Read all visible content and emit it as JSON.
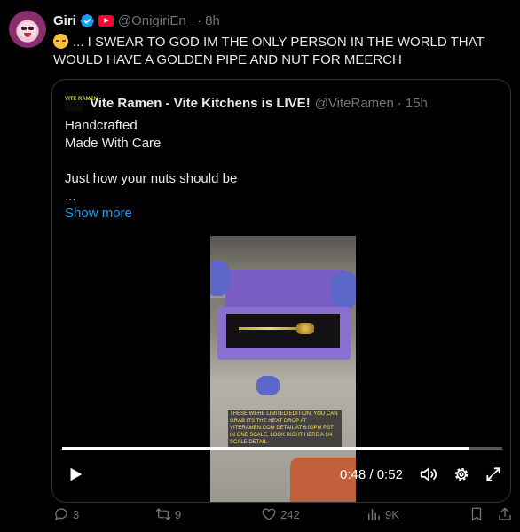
{
  "post": {
    "author_name": "Giri",
    "handle": "@OnigiriEn_",
    "separator": "·",
    "time": "8h",
    "text": "... I SWEAR TO GOD IM THE ONLY PERSON IN THE WORLD THAT WOULD HAVE A GOLDEN PIPE AND NUT FOR MEERCH"
  },
  "quote": {
    "avatar_text": "VITE RAMEN",
    "author_name": "Vite Ramen - Vite Kitchens is LIVE!",
    "handle": "@ViteRamen",
    "separator": "·",
    "time": "15h",
    "lines": [
      "Handcrafted",
      "Made With Care",
      "",
      "Just how your nuts should be",
      "..."
    ],
    "show_more": "Show more",
    "video": {
      "caption": "THESE WERE LIMITED EDITION, YOU CAN GRAB ITS THE NEXT DROP AT VITERAMEN.COM DETAIL AT 6:00PM PST IN ONE SCALE, LOOK RIGHT HERE A 1/4 SCALE DETAIL",
      "current_time": "0:48",
      "time_separator": "/",
      "duration": "0:52",
      "progress_fraction": 0.923
    }
  },
  "actions": {
    "replies": "3",
    "reposts": "9",
    "likes": "242",
    "views": "9K"
  },
  "colors": {
    "accent": "#1d9bf0",
    "muted": "#71767b",
    "border": "#2f3336",
    "background": "#000000"
  }
}
